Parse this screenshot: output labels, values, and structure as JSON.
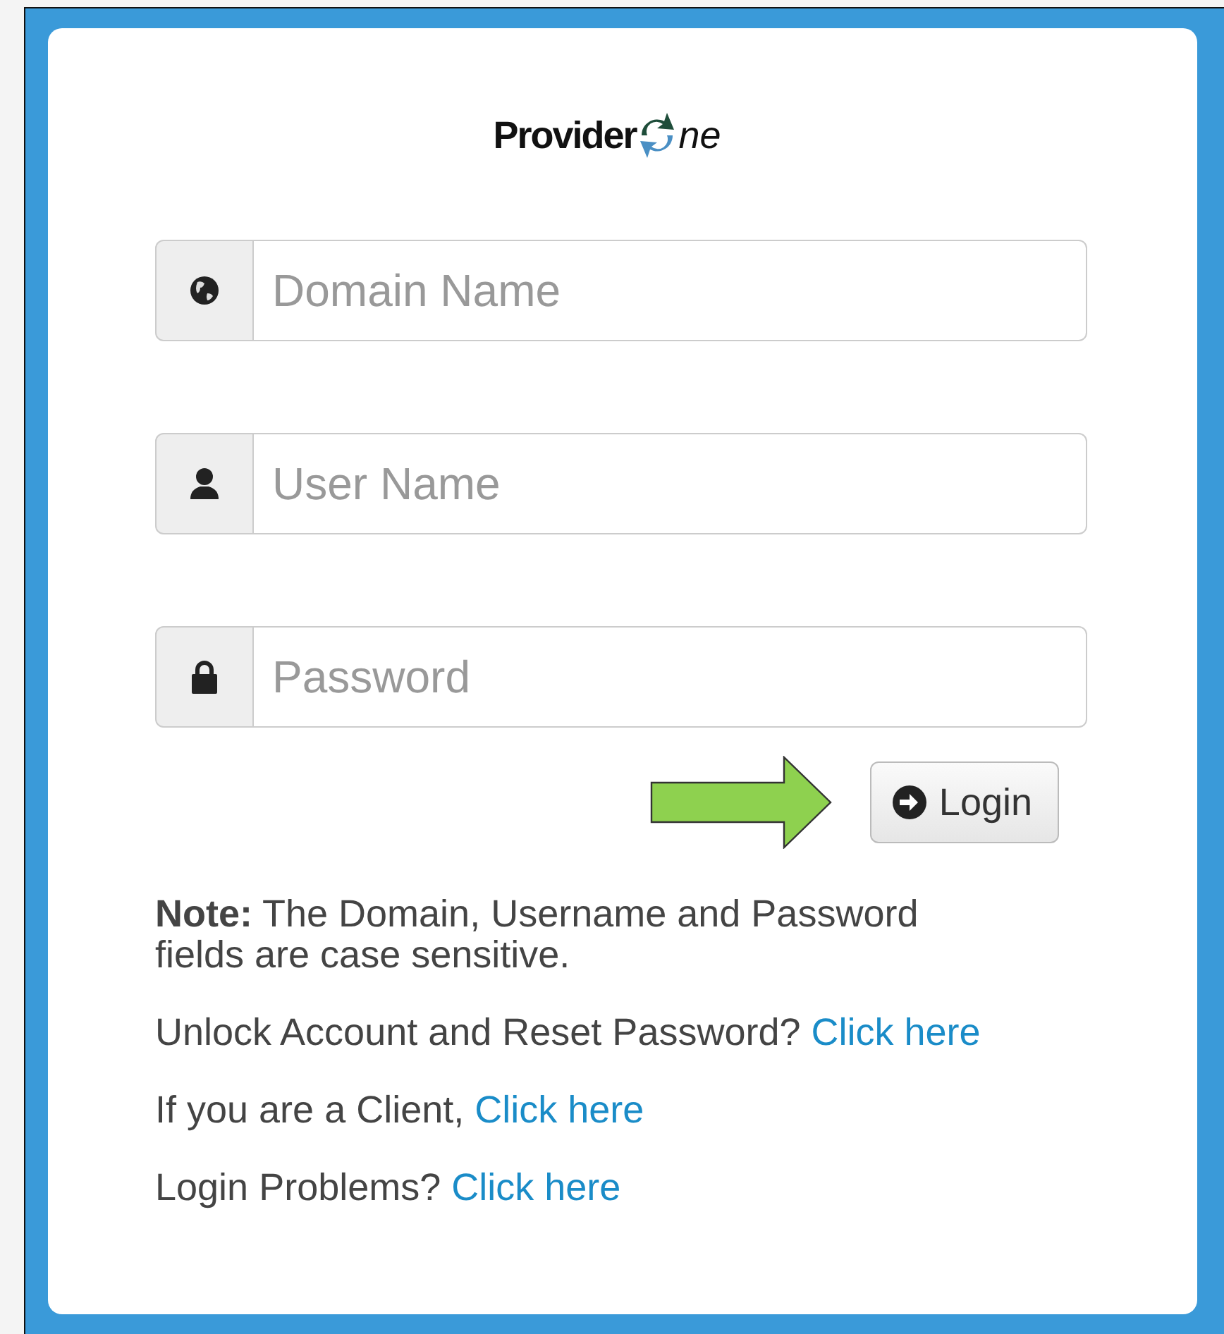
{
  "logo": {
    "text_before": "Provider",
    "text_after": "ne"
  },
  "fields": [
    {
      "kind": "globe",
      "placeholder": "Domain Name"
    },
    {
      "kind": "user",
      "placeholder": "User Name"
    },
    {
      "kind": "lock",
      "placeholder": "Password"
    }
  ],
  "login_button": {
    "label": "Login"
  },
  "note": "**Note:** The Domain, Username and Password fields are case sensitive.",
  "help_lines": [
    {
      "text": "Unlock Account and Reset Password?",
      "link": "Click here"
    },
    {
      "text": "If you are a Client,",
      "link": "Click here"
    },
    {
      "text": "Login Problems?",
      "link": "Click here"
    }
  ]
}
